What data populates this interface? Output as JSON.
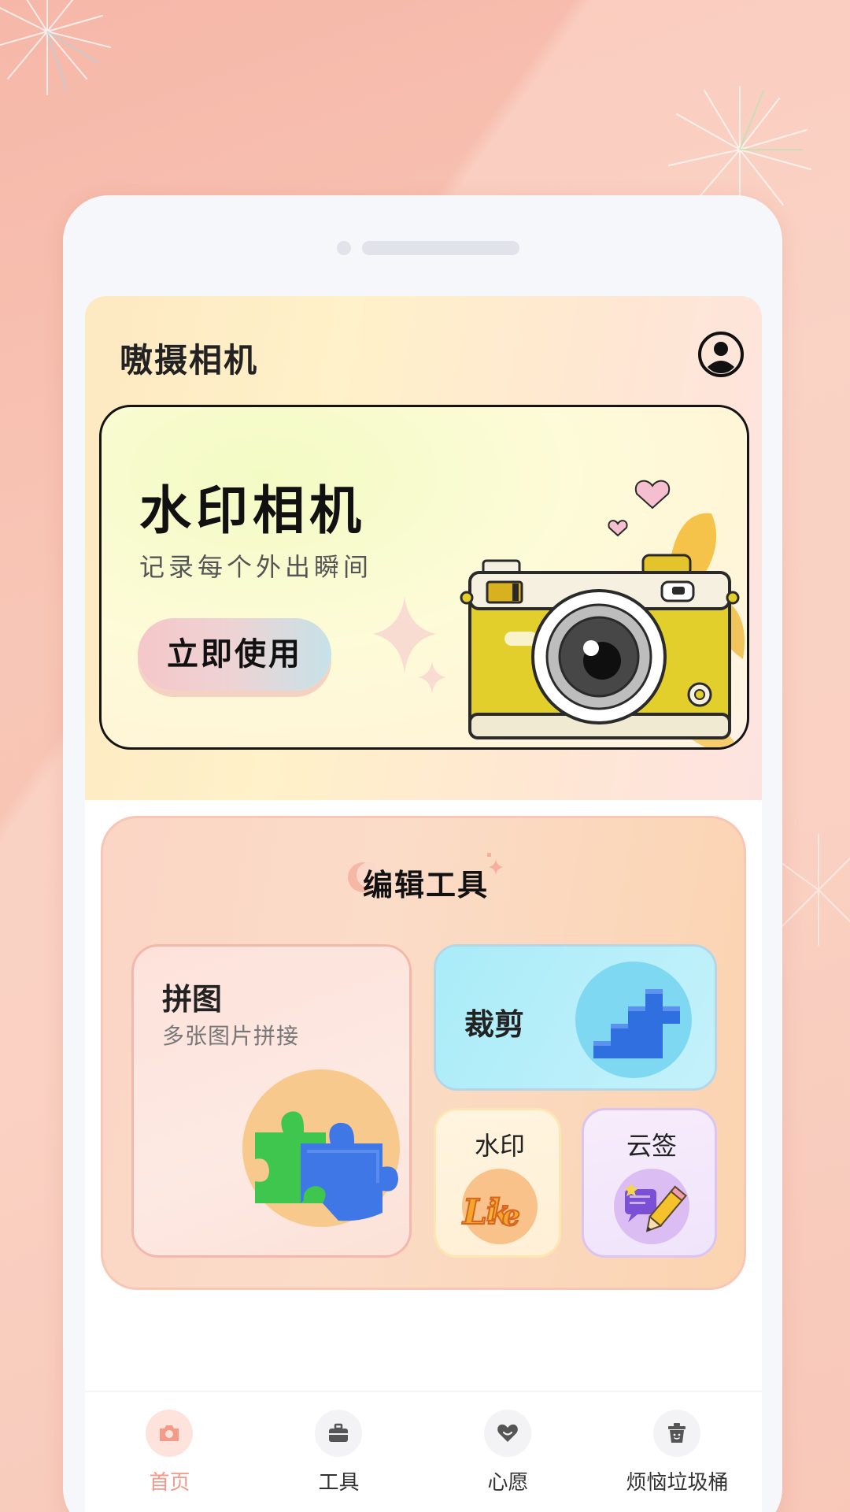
{
  "app": {
    "title": "嗷摄相机"
  },
  "icons": {
    "profile": "user-circle-icon",
    "sparkle": "sparkle-icon",
    "camera_illustration": "camera-illustration",
    "puzzle": "puzzle-icon",
    "cube": "pixel-cube-icon",
    "like": "like-lettering-icon",
    "sign": "pencil-note-icon",
    "tab_home": "camera-icon",
    "tab_tools": "briefcase-icon",
    "tab_wish": "heart-icon",
    "tab_trash": "trash-icon"
  },
  "banner": {
    "title": "水印相机",
    "subtitle": "记录每个外出瞬间",
    "cta": "立即使用"
  },
  "tools": {
    "title": "编辑工具",
    "collage": {
      "title": "拼图",
      "subtitle": "多张图片拼接"
    },
    "crop": {
      "title": "裁剪"
    },
    "watermark": {
      "title": "水印"
    },
    "sign": {
      "title": "云签"
    }
  },
  "tabbar": {
    "items": [
      {
        "label": "首页",
        "active": true
      },
      {
        "label": "工具",
        "active": false
      },
      {
        "label": "心愿",
        "active": false
      },
      {
        "label": "烦恼垃圾桶",
        "active": false
      }
    ]
  },
  "colors": {
    "accent": "#f19a8a",
    "banner_camera_body": "#e3cf2c",
    "crop_card": "#a9ecf8",
    "sign_card": "#efe4fb"
  }
}
